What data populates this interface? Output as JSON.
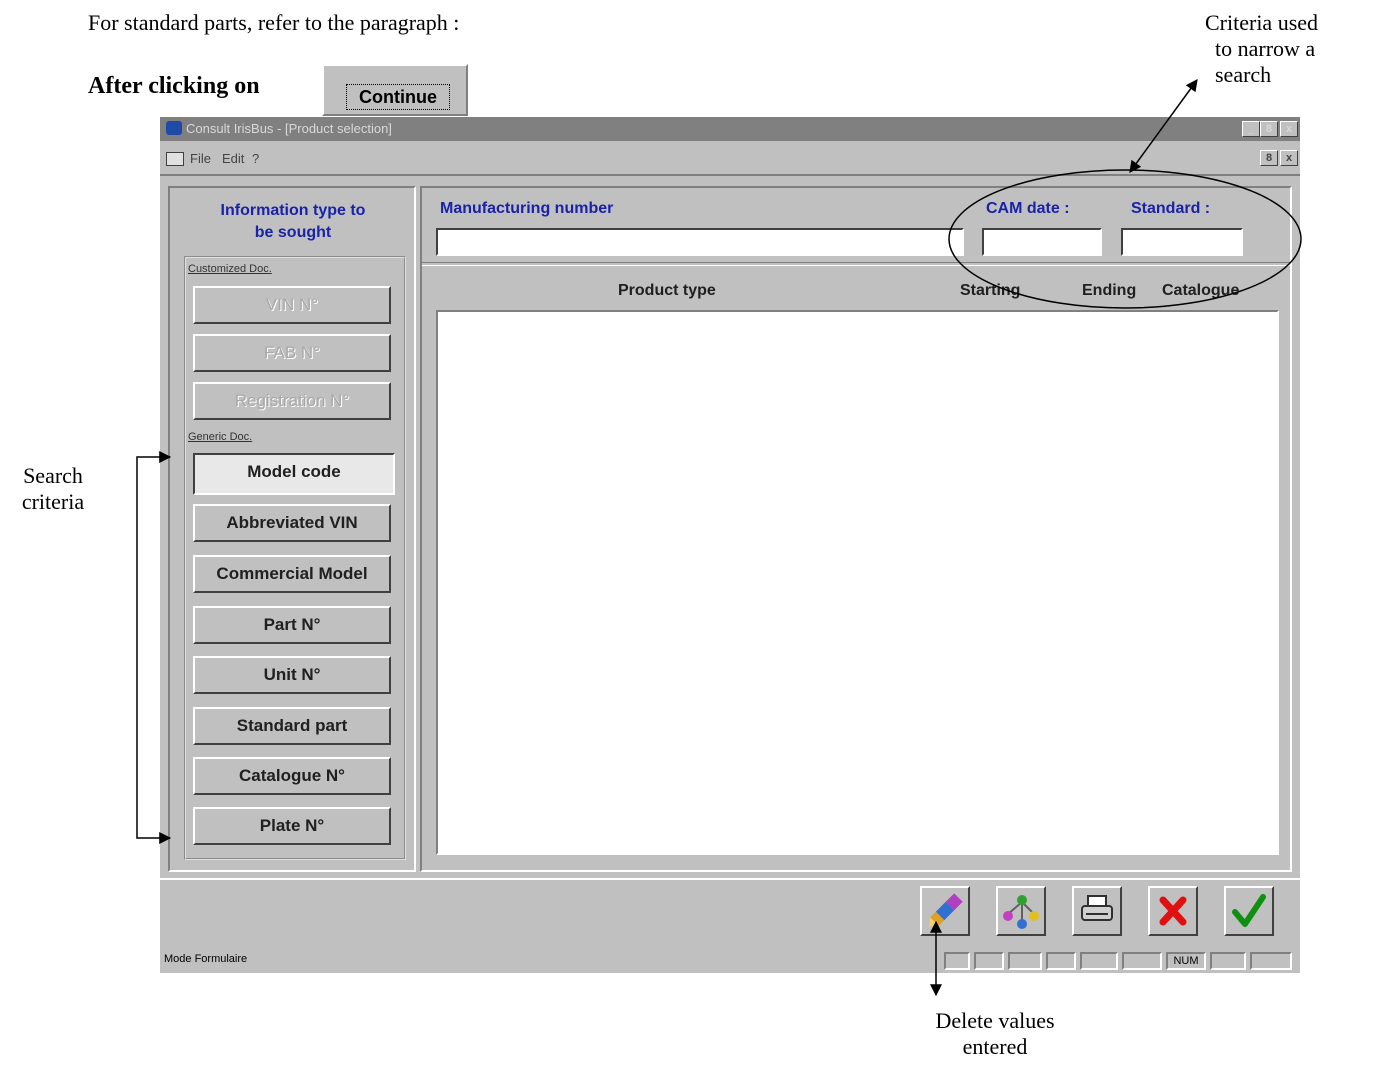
{
  "document": {
    "intro": "For standard parts, refer to the paragraph :",
    "after_clicking": "After clicking on",
    "continue_button": "Continue"
  },
  "annotations": {
    "criteria_top": [
      "Criteria used",
      "to narrow a",
      "search"
    ],
    "search_criteria": [
      "Search",
      "criteria"
    ],
    "delete_values": [
      "Delete values",
      "entered"
    ]
  },
  "window": {
    "title": "Consult IrisBus - [Product selection]",
    "controls": [
      "_",
      "8",
      "x"
    ],
    "menu": [
      "File",
      "Edit",
      "?"
    ],
    "mdi_controls": [
      "8",
      "x"
    ]
  },
  "left_panel": {
    "title_line1": "Information type to",
    "title_line2": "be sought",
    "group_customized": "Customized Doc.",
    "group_generic": "Generic Doc.",
    "customized_buttons": [
      "VIN N°",
      "FAB N°",
      "Registration N°"
    ],
    "generic_buttons": [
      "Model code",
      "Abbreviated VIN",
      "Commercial Model",
      "Part N°",
      "Unit N°",
      "Standard part",
      "Catalogue N°",
      "Plate N°"
    ]
  },
  "right_panel": {
    "manufacturing_label": "Manufacturing number",
    "manufacturing_value": "",
    "cam_label": "CAM date :",
    "cam_value": "",
    "standard_label": "Standard :",
    "standard_value": "",
    "columns": [
      "Product type",
      "Starting",
      "Ending",
      "Catalogue"
    ],
    "rows": []
  },
  "toolbar": {
    "buttons": [
      "eraser-icon",
      "network-icon",
      "printer-icon",
      "cancel-icon",
      "validate-icon"
    ]
  },
  "status_bar": {
    "mode": "Mode Formulaire",
    "num": "NUM"
  },
  "colors": {
    "window_bg": "#c0c0c0",
    "label_blue": "#1a22a8",
    "cancel_red": "#e01010",
    "validate_green": "#109010"
  }
}
